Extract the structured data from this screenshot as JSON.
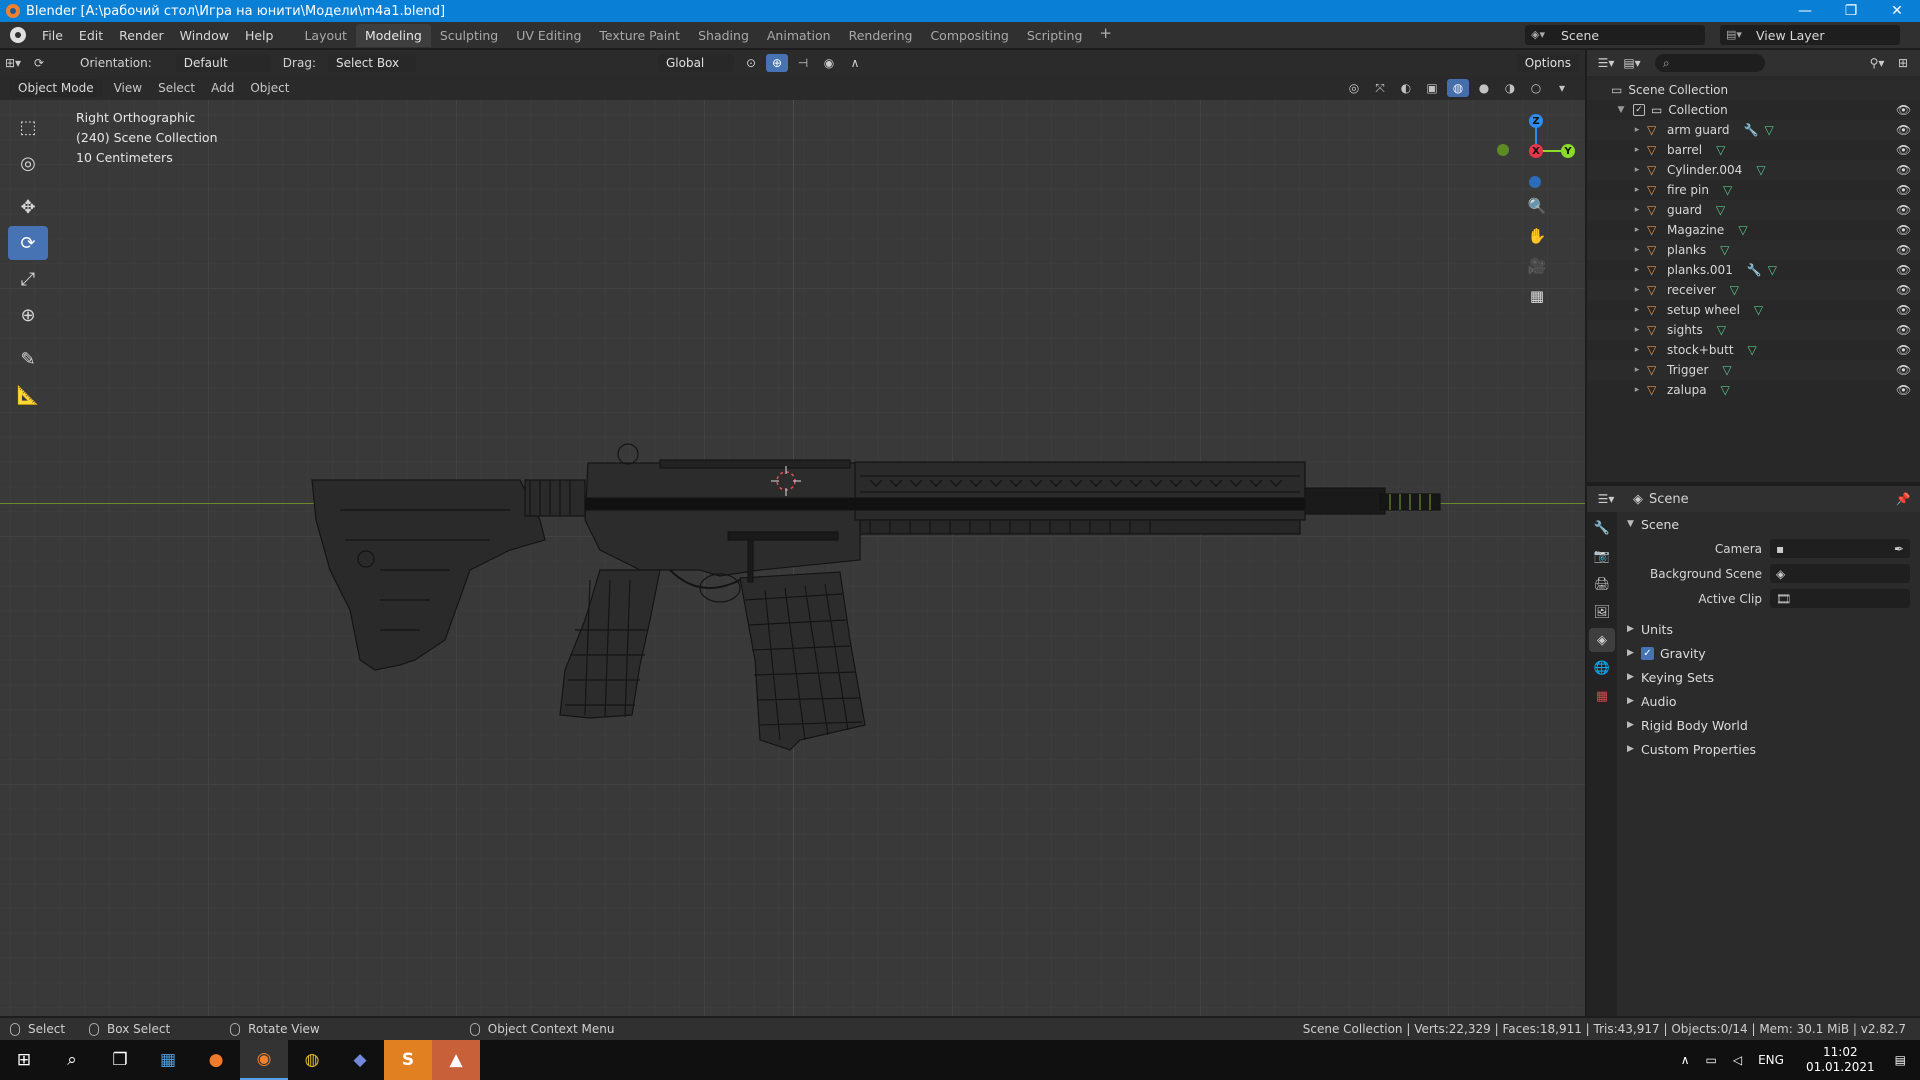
{
  "window": {
    "title": "Blender [A:\\рабочий стол\\Игра на юнити\\Модели\\m4a1.blend]"
  },
  "menu": [
    "File",
    "Edit",
    "Render",
    "Window",
    "Help"
  ],
  "workspaces": [
    {
      "label": "Layout",
      "active": false
    },
    {
      "label": "Modeling",
      "active": true
    },
    {
      "label": "Sculpting",
      "active": false
    },
    {
      "label": "UV Editing",
      "active": false
    },
    {
      "label": "Texture Paint",
      "active": false
    },
    {
      "label": "Shading",
      "active": false
    },
    {
      "label": "Animation",
      "active": false
    },
    {
      "label": "Rendering",
      "active": false
    },
    {
      "label": "Compositing",
      "active": false
    },
    {
      "label": "Scripting",
      "active": false
    }
  ],
  "scene_selector": "Scene",
  "view_layer": "View Layer",
  "tool_header": {
    "orientation_label": "Orientation:",
    "orientation_value": "Default",
    "drag_label": "Drag:",
    "drag_value": "Select Box",
    "transform_orientation": "Global",
    "options": "Options"
  },
  "view_header": {
    "mode": "Object Mode",
    "menus": [
      "View",
      "Select",
      "Add",
      "Object"
    ]
  },
  "viewport": {
    "view_name": "Right Orthographic",
    "collection": "(240) Scene Collection",
    "scale": "10 Centimeters",
    "gizmo": {
      "z": "Z",
      "y": "Y",
      "x": "X"
    }
  },
  "outliner": {
    "root": "Scene Collection",
    "collection": "Collection",
    "objects": [
      {
        "name": "arm guard",
        "modifier": true
      },
      {
        "name": "barrel",
        "modifier": false
      },
      {
        "name": "Cylinder.004",
        "modifier": false
      },
      {
        "name": "fire pin",
        "modifier": false
      },
      {
        "name": "guard",
        "modifier": false
      },
      {
        "name": "Magazine",
        "modifier": false
      },
      {
        "name": "planks",
        "modifier": false
      },
      {
        "name": "planks.001",
        "modifier": true
      },
      {
        "name": "receiver",
        "modifier": false
      },
      {
        "name": "setup wheel",
        "modifier": false
      },
      {
        "name": "sights",
        "modifier": false
      },
      {
        "name": "stock+butt",
        "modifier": false
      },
      {
        "name": "Trigger",
        "modifier": false
      },
      {
        "name": "zalupa",
        "modifier": false
      }
    ]
  },
  "properties": {
    "context": "Scene",
    "panel": "Scene",
    "fields": [
      {
        "label": "Camera"
      },
      {
        "label": "Background Scene"
      },
      {
        "label": "Active Clip"
      }
    ],
    "subpanels": [
      "Units",
      "Gravity",
      "Keying Sets",
      "Audio",
      "Rigid Body World",
      "Custom Properties"
    ]
  },
  "statusbar": {
    "select": "Select",
    "box_select": "Box Select",
    "rotate_view": "Rotate View",
    "context_menu": "Object Context Menu",
    "stats": "Scene Collection | Verts:22,329 | Faces:18,911 | Tris:43,917 | Objects:0/14 | Mem: 30.1 MiB | v2.82.7"
  },
  "taskbar": {
    "lang": "ENG",
    "time": "11:02",
    "date": "01.01.2021"
  },
  "colors": {
    "accent": "#4772b3",
    "titlebar": "#0a7fd6",
    "object_icon": "#e4924a",
    "mesh_icon": "#5ac48a",
    "axis_x": "#e8354b",
    "axis_y": "#8bdb2a",
    "axis_z": "#2f8cf0"
  }
}
